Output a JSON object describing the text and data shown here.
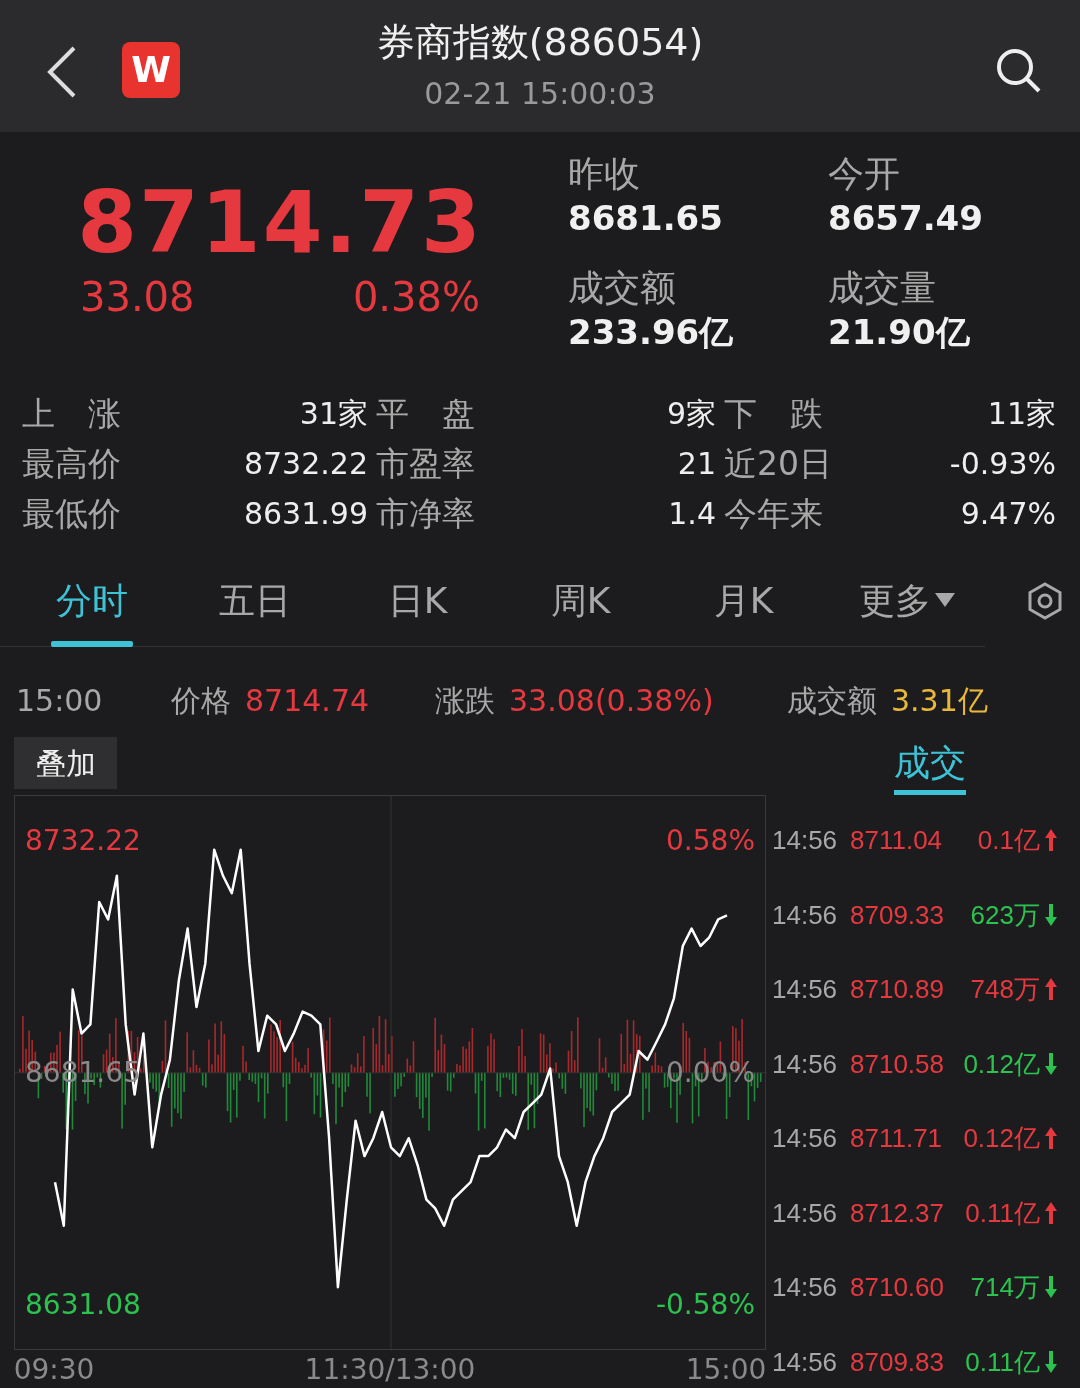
{
  "header": {
    "title": "券商指数(886054)",
    "subtitle": "02-21 15:00:03",
    "logo": "W"
  },
  "quote": {
    "price": "8714.73",
    "change": "33.08",
    "change_pct": "0.38%",
    "fields": [
      {
        "label": "昨收",
        "value": "8681.65"
      },
      {
        "label": "今开",
        "value": "8657.49"
      },
      {
        "label": "成交额",
        "value": "233.96亿"
      },
      {
        "label": "成交量",
        "value": "21.90亿"
      }
    ]
  },
  "stats": [
    [
      {
        "label": "上　涨",
        "value": "31家"
      },
      {
        "label": "平　盘",
        "value": "9家"
      },
      {
        "label": "下　跌",
        "value": "11家"
      }
    ],
    [
      {
        "label": "最高价",
        "value": "8732.22"
      },
      {
        "label": "市盈率",
        "value": "21"
      },
      {
        "label": "近20日",
        "value": "-0.93%"
      }
    ],
    [
      {
        "label": "最低价",
        "value": "8631.99"
      },
      {
        "label": "市净率",
        "value": "1.4"
      },
      {
        "label": "今年来",
        "value": "9.47%"
      }
    ]
  ],
  "tabs": [
    {
      "label": "分时",
      "selected": true,
      "dropdown": false
    },
    {
      "label": "五日",
      "selected": false,
      "dropdown": false
    },
    {
      "label": "日K",
      "selected": false,
      "dropdown": false
    },
    {
      "label": "周K",
      "selected": false,
      "dropdown": false
    },
    {
      "label": "月K",
      "selected": false,
      "dropdown": false
    },
    {
      "label": "更多",
      "selected": false,
      "dropdown": true
    }
  ],
  "info_bar": {
    "time": "15:00",
    "price_label": "价格",
    "price": "8714.74",
    "change_label": "涨跌",
    "change": "33.08(0.38%)",
    "amount_label": "成交额",
    "amount": "3.31亿"
  },
  "overlay_button": "叠加",
  "trades_tab": {
    "label": "成交",
    "selected": true
  },
  "chart": {
    "percent_labels": [
      {
        "label": "0.58%",
        "kind": "up"
      },
      {
        "label": "0.00%",
        "kind": "flat"
      },
      {
        "label": "-0.58%",
        "kind": "down"
      }
    ],
    "chart_data": {
      "type": "line",
      "ylim": [
        8621,
        8742
      ],
      "categories": [
        "09:30",
        null,
        null,
        null,
        null,
        null,
        null,
        null,
        null,
        null,
        null,
        null,
        null,
        null,
        null,
        null,
        null,
        null,
        null,
        null,
        null,
        null,
        null,
        null,
        null,
        null,
        null,
        null,
        null,
        null,
        null,
        null,
        null,
        null,
        null,
        null,
        null,
        null,
        "11:30/13:00",
        null,
        null,
        null,
        null,
        null,
        null,
        null,
        null,
        null,
        null,
        null,
        null,
        null,
        null,
        null,
        null,
        null,
        null,
        null,
        null,
        null,
        null,
        null,
        null,
        null,
        null,
        null,
        null,
        null,
        null,
        null,
        null,
        null,
        null,
        null,
        null,
        null,
        "15:00"
      ],
      "yticks": [
        {
          "value": 8732.22,
          "label": "8732.22"
        },
        {
          "value": 8681.65,
          "label": "8681.65"
        },
        {
          "value": 8631.08,
          "label": "8631.08"
        }
      ],
      "series": [
        {
          "color": "#ffffff",
          "values": [
            8657.8,
            8648.3,
            8699.8,
            8690.2,
            8692.2,
            8718.9,
            8715.1,
            8724.6,
            8692.2,
            8676.9,
            8690.2,
            8665.4,
            8676.9,
            8684.5,
            8701.7,
            8713.1,
            8696.0,
            8705.5,
            8730.3,
            8724.6,
            8720.8,
            8730.3,
            8705.5,
            8686.4,
            8694.1,
            8692.2,
            8686.4,
            8690.2,
            8695.0,
            8694.1,
            8692.2,
            8667.4,
            8634.9,
            8654.0,
            8671.2,
            8663.5,
            8667.4,
            8673.1,
            8665.4,
            8663.5,
            8667.4,
            8661.6,
            8654.0,
            8652.1,
            8648.3,
            8654.0,
            8655.9,
            8657.8,
            8663.5,
            8663.5,
            8665.4,
            8669.3,
            8667.4,
            8673.1,
            8675.0,
            8676.9,
            8682.6,
            8663.5,
            8657.8,
            8648.3,
            8657.8,
            8663.5,
            8667.4,
            8673.1,
            8675.0,
            8676.9,
            8686.4,
            8684.5,
            8688.3,
            8692.2,
            8697.9,
            8709.3,
            8713.1,
            8709.3,
            8711.2,
            8715.1,
            8716.0
          ]
        }
      ]
    }
  },
  "trades": [
    {
      "time": "14:56",
      "price": "8711.04",
      "volume": "0.1亿",
      "kind": "up"
    },
    {
      "time": "14:56",
      "price": "8709.33",
      "volume": "623万",
      "kind": "down"
    },
    {
      "time": "14:56",
      "price": "8710.89",
      "volume": "748万",
      "kind": "up"
    },
    {
      "time": "14:56",
      "price": "8710.58",
      "volume": "0.12亿",
      "kind": "down"
    },
    {
      "time": "14:56",
      "price": "8711.71",
      "volume": "0.12亿",
      "kind": "up"
    },
    {
      "time": "14:56",
      "price": "8712.37",
      "volume": "0.11亿",
      "kind": "up"
    },
    {
      "time": "14:56",
      "price": "8710.60",
      "volume": "714万",
      "kind": "down"
    },
    {
      "time": "14:56",
      "price": "8709.83",
      "volume": "0.11亿",
      "kind": "down"
    }
  ]
}
